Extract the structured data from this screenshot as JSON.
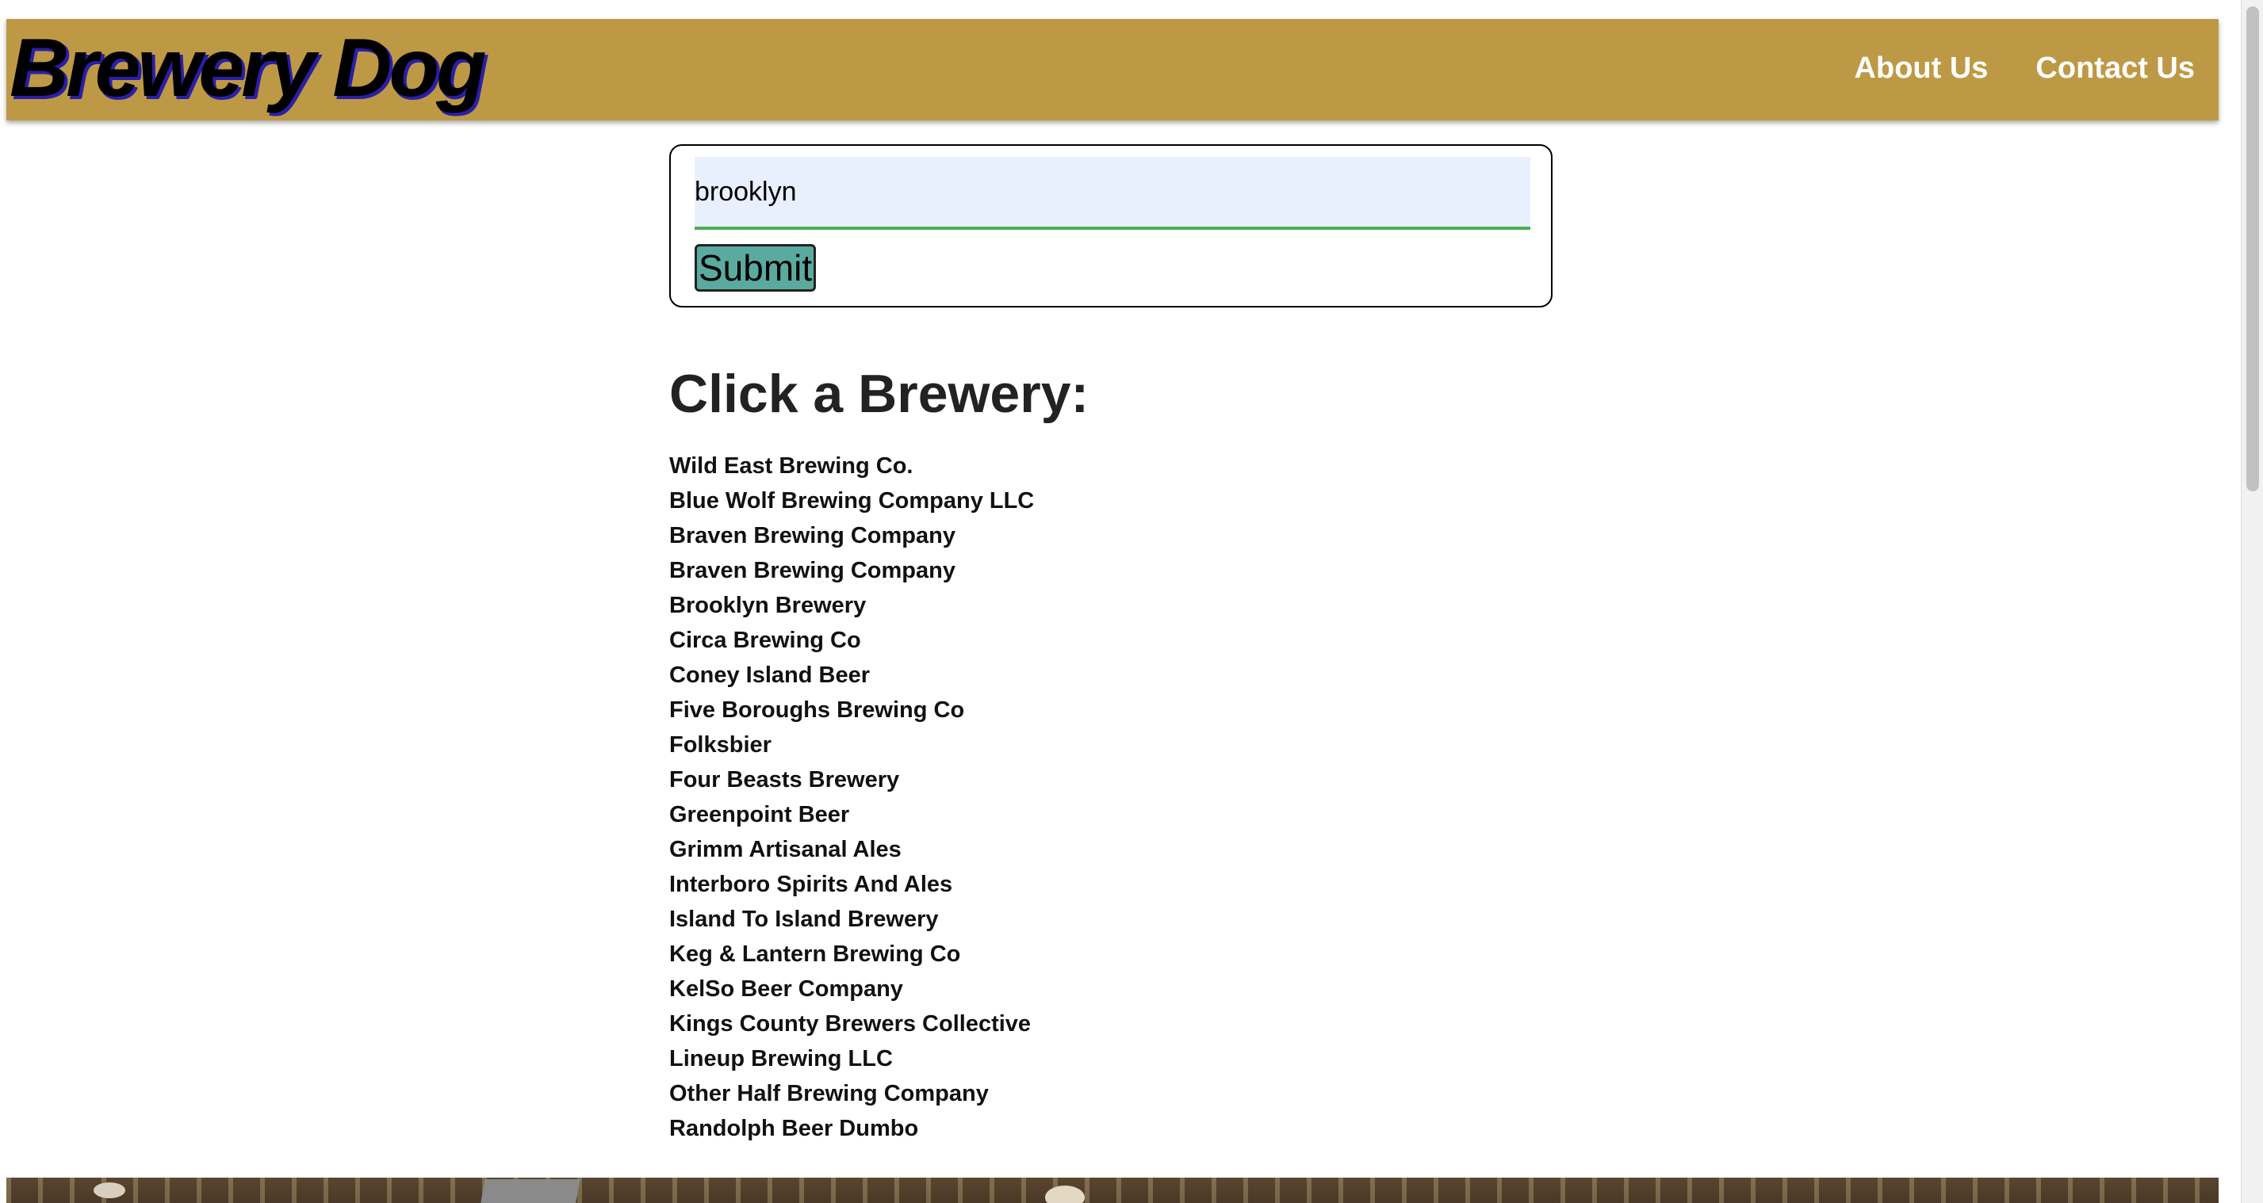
{
  "header": {
    "logo_text": "Brewery Dog",
    "nav": {
      "about": "About Us",
      "contact": "Contact Us"
    },
    "background_color": "#be9945"
  },
  "search": {
    "value": "brooklyn",
    "submit_label": "Submit"
  },
  "list": {
    "heading": "Click a Brewery:",
    "breweries": [
      "Wild East Brewing Co.",
      "Blue Wolf Brewing Company LLC",
      "Braven Brewing Company",
      "Braven Brewing Company",
      "Brooklyn Brewery",
      "Circa Brewing Co",
      "Coney Island Beer",
      "Five Boroughs Brewing Co",
      "Folksbier",
      "Four Beasts Brewery",
      "Greenpoint Beer",
      "Grimm Artisanal Ales",
      "Interboro Spirits And Ales",
      "Island To Island Brewery",
      "Keg & Lantern Brewing Co",
      "KelSo Beer Company",
      "Kings County Brewers Collective",
      "Lineup Brewing LLC",
      "Other Half Brewing Company",
      "Randolph Beer Dumbo"
    ]
  },
  "colors": {
    "submit_button": "#5baa9f",
    "input_background": "#e8f0fe",
    "input_underline": "#4caf50"
  }
}
